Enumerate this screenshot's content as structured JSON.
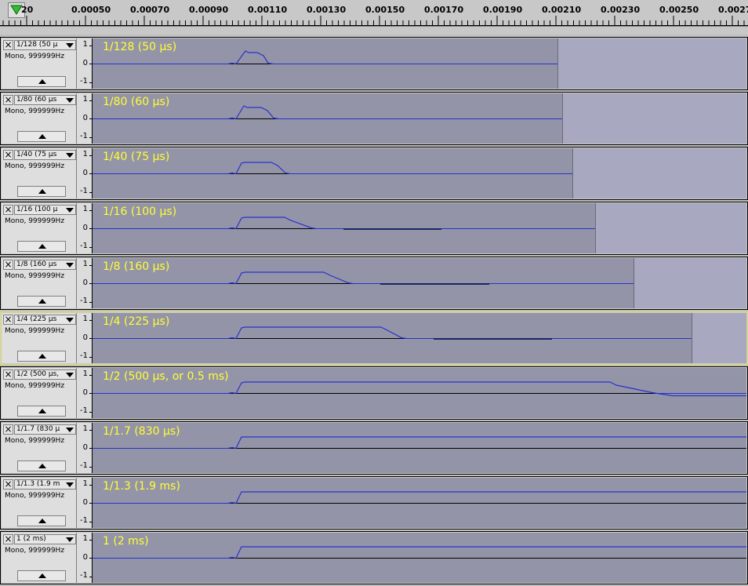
{
  "ruler": {
    "labels": [
      "20",
      "0.00050",
      "0.00070",
      "0.00090",
      "0.00110",
      "0.00130",
      "0.00150",
      "0.00170",
      "0.00190",
      "0.00210",
      "0.00230",
      "0.00250",
      "0.0027"
    ]
  },
  "icons": {
    "play_head": "playhead-down-triangle-icon",
    "close": "close-x-icon",
    "menu": "dropdown-arrow-icon",
    "collapse": "collapse-up-triangle-icon"
  },
  "colors": {
    "waveform": "#2633cc",
    "clip_label": "#ffff33",
    "clip_bg": "#9494a8",
    "empty_bg": "#a8a8c0",
    "selected_border": "#e0e060"
  },
  "vertical_ruler": {
    "top": "1",
    "mid": "0",
    "bottom": "-1"
  },
  "tracks": [
    {
      "name": "1/128 (50 µ",
      "format": "Mono, 999999Hz",
      "label": "1/128 (50 µs)"
    },
    {
      "name": "1/80 (60 µs",
      "format": "Mono, 999999Hz",
      "label": "1/80 (60 µs)"
    },
    {
      "name": "1/40 (75 µs",
      "format": "Mono, 999999Hz",
      "label": "1/40 (75 µs)"
    },
    {
      "name": "1/16 (100 µ",
      "format": "Mono, 999999Hz",
      "label": "1/16 (100 µs)"
    },
    {
      "name": "1/8 (160 µs",
      "format": "Mono, 999999Hz",
      "label": "1/8 (160 µs)"
    },
    {
      "name": "1/4 (225 µs",
      "format": "Mono, 999999Hz",
      "label": "1/4 (225 µs)"
    },
    {
      "name": "1/2 (500 µs,",
      "format": "Mono, 999999Hz",
      "label": "1/2 (500 µs, or 0.5 ms)"
    },
    {
      "name": "1/1.7 (830 µ",
      "format": "Mono, 999999Hz",
      "label": "1/1.7 (830 µs)"
    },
    {
      "name": "1/1.3 (1.9 m",
      "format": "Mono, 999999Hz",
      "label": "1/1.3 (1.9 ms)"
    },
    {
      "name": "1 (2 ms)",
      "format": "Mono, 999999Hz",
      "label": "1 (2 ms)"
    }
  ]
}
